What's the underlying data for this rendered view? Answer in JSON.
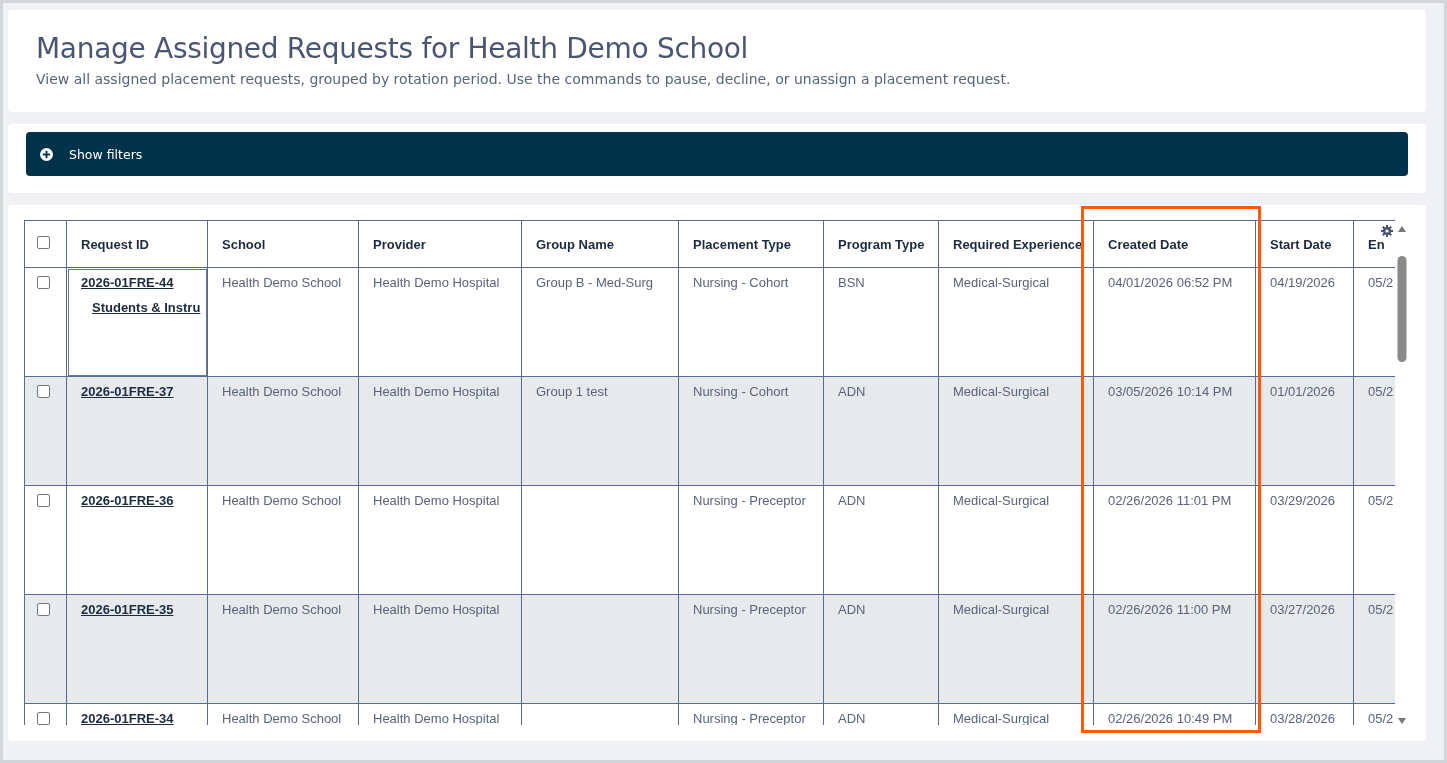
{
  "header": {
    "title": "Manage Assigned Requests for Health Demo School",
    "subtitle": "View all assigned placement requests, grouped by rotation period. Use the commands to pause, decline, or unassign a placement request."
  },
  "filters": {
    "label": "Show filters",
    "expanded": false
  },
  "table": {
    "select_all": {
      "checked": false
    },
    "columns": [
      {
        "label": "Request ID",
        "highlighted": false
      },
      {
        "label": "School",
        "highlighted": false
      },
      {
        "label": "Provider",
        "highlighted": false
      },
      {
        "label": "Group Name",
        "highlighted": false
      },
      {
        "label": "Placement Type",
        "highlighted": false
      },
      {
        "label": "Program Type",
        "highlighted": false
      },
      {
        "label": "Required Experience",
        "highlighted": false
      },
      {
        "label": "Created Date",
        "highlighted": true
      },
      {
        "label": "Start Date",
        "highlighted": false
      },
      {
        "label": "En",
        "highlighted": false
      }
    ],
    "rows": [
      {
        "checked": false,
        "focused": true,
        "sub_link": "Students & Instru",
        "cells": [
          "2026-01FRE-44",
          "Health Demo School",
          "Health Demo Hospital",
          "Group B - Med-Surg",
          "Nursing - Cohort",
          "BSN",
          "Medical-Surgical",
          "04/01/2026 06:52 PM",
          "04/19/2026",
          "05/2"
        ]
      },
      {
        "checked": false,
        "focused": false,
        "cells": [
          "2026-01FRE-37",
          "Health Demo School",
          "Health Demo Hospital",
          "Group 1 test",
          "Nursing - Cohort",
          "ADN",
          "Medical-Surgical",
          "03/05/2026 10:14 PM",
          "01/01/2026",
          "05/2"
        ]
      },
      {
        "checked": false,
        "focused": false,
        "cells": [
          "2026-01FRE-36",
          "Health Demo School",
          "Health Demo Hospital",
          "",
          "Nursing - Preceptor",
          "ADN",
          "Medical-Surgical",
          "02/26/2026 11:01 PM",
          "03/29/2026",
          "05/2"
        ]
      },
      {
        "checked": false,
        "focused": false,
        "cells": [
          "2026-01FRE-35",
          "Health Demo School",
          "Health Demo Hospital",
          "",
          "Nursing - Preceptor",
          "ADN",
          "Medical-Surgical",
          "02/26/2026 11:00 PM",
          "03/27/2026",
          "05/2"
        ]
      },
      {
        "checked": false,
        "focused": false,
        "cells": [
          "2026-01FRE-34",
          "Health Demo School",
          "Health Demo Hospital",
          "",
          "Nursing - Preceptor",
          "ADN",
          "Medical-Surgical",
          "02/26/2026 10:49 PM",
          "03/28/2026",
          "05/2"
        ]
      }
    ]
  }
}
